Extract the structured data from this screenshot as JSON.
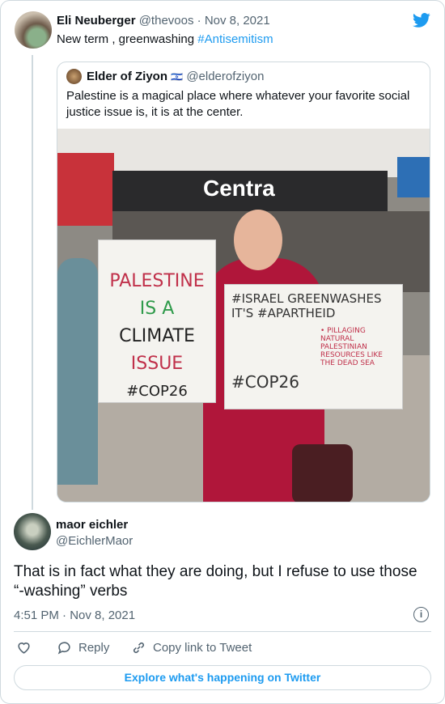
{
  "parent_tweet": {
    "author_name": "Eli Neuberger",
    "handle": "@thevoos",
    "separator": "·",
    "date": "Nov 8, 2021",
    "text": "New term , greenwashing ",
    "hashtag": "#Antisemitism"
  },
  "quoted_tweet": {
    "author_name": "Elder of Ziyon",
    "flag": "🇮🇱",
    "handle": "@elderofziyon",
    "text": "Palestine is a magical place where whatever your favorite social justice issue is, it is at the center.",
    "photo": {
      "store_sign": "Centra",
      "left_sign": [
        "PALESTINE",
        "IS A",
        "CLIMATE",
        "ISSUE",
        "#COP26"
      ],
      "right_sign": [
        "#ISRAEL GREENWASHES",
        "IT'S #APARTHEID",
        "• PILLAGING NATURAL PALESTINIAN RESOURCES LIKE THE DEAD SEA",
        "#COP26"
      ]
    }
  },
  "reply_tweet": {
    "author_name": "maor eichler",
    "handle": "@EichlerMaor",
    "text": "That is in fact what they are doing, but I refuse to use those “-washing” verbs",
    "timestamp": "4:51 PM · Nov 8, 2021"
  },
  "actions": {
    "reply": "Reply",
    "copy_link": "Copy link to Tweet"
  },
  "explore_button": "Explore what's happening on Twitter",
  "colors": {
    "accent": "#1d9bf0",
    "border": "#cfd9de"
  }
}
